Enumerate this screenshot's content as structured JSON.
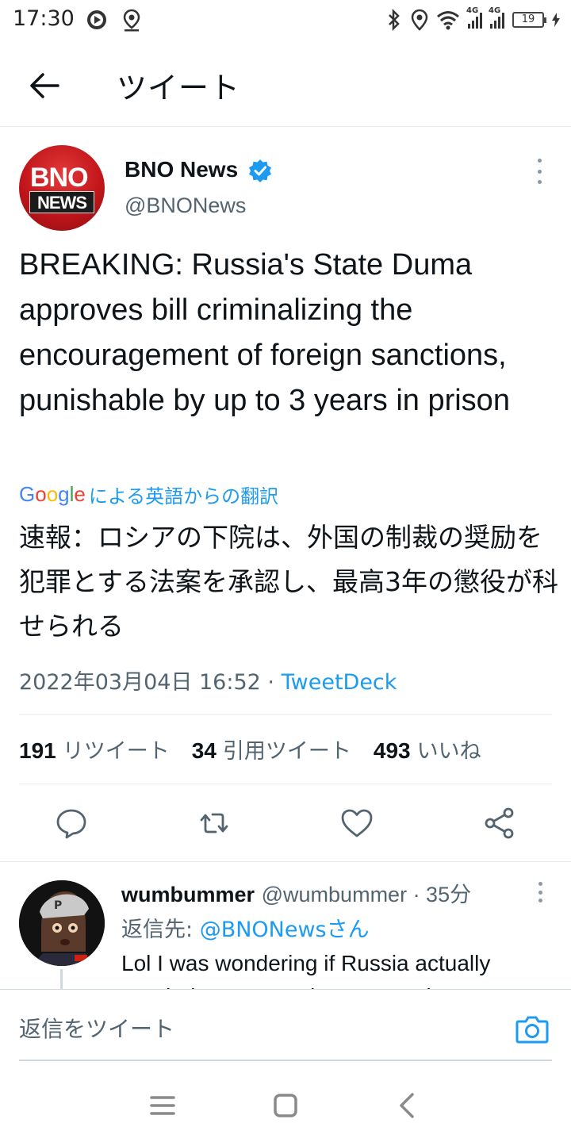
{
  "status_bar": {
    "time": "17:30",
    "signal1_tag": "4G",
    "signal2_tag": "4G",
    "battery": "19"
  },
  "header": {
    "title": "ツイート"
  },
  "tweet": {
    "author_name": "BNO News",
    "author_handle": "@BNONews",
    "avatar_top": "BNO",
    "avatar_bottom": "NEWS",
    "text": "BREAKING: Russia's State Duma approves bill criminalizing the encouragement of foreign sanctions, punishable by up to 3 years in prison",
    "translate_brand": "Google",
    "translate_label": "による英語からの翻訳",
    "translated_text": "速報：ロシアの下院は、外国の制裁の奨励を犯罪とする法案を承認し、最高3年の懲役が科せられる",
    "timestamp": "2022年03月04日 16:52",
    "separator": "·",
    "source": "TweetDeck",
    "retweets_count": "191",
    "retweets_label": "リツイート",
    "quotes_count": "34",
    "quotes_label": "引用ツイート",
    "likes_count": "493",
    "likes_label": "いいね"
  },
  "reply": {
    "name": "wumbummer",
    "handle": "@wumbummer · 35分",
    "reply_to_prefix": "返信先: ",
    "reply_to_mention": "@BNONewsさん",
    "text": "Lol I was wondering if Russia actually needed extra sanctions. Now I know..."
  },
  "compose": {
    "placeholder": "返信をツイート"
  },
  "colors": {
    "accent": "#1d9bf0",
    "text": "#0f1419",
    "secondary": "#536471",
    "divider": "#e6ecf0"
  }
}
